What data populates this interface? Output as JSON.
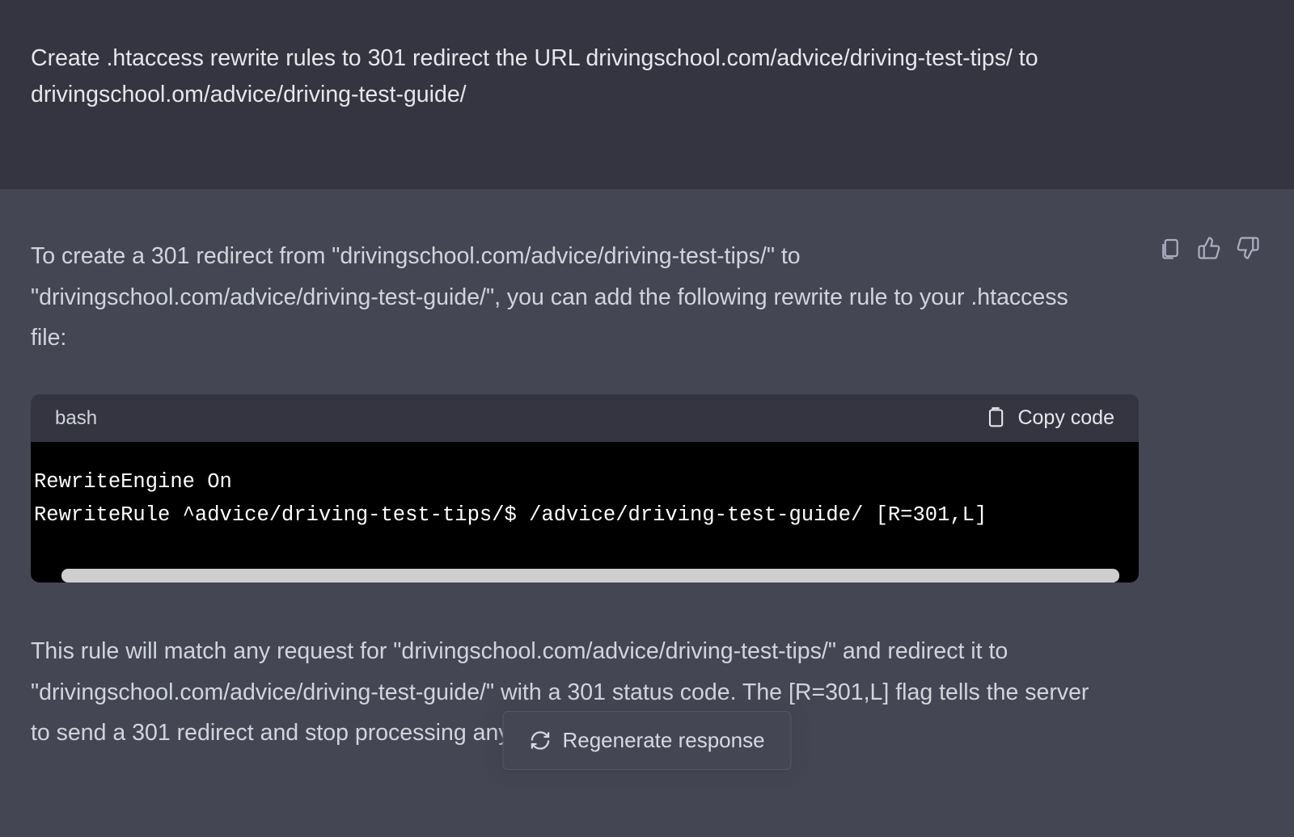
{
  "user": {
    "message": "Create .htaccess rewrite rules to 301 redirect the URL drivingschool.com/advice/driving-test-tips/ to drivingschool.om/advice/driving-test-guide/"
  },
  "assistant": {
    "intro": "To create a 301 redirect from \"drivingschool.com/advice/driving-test-tips/\" to \"drivingschool.com/advice/driving-test-guide/\", you can add the following rewrite rule to your .htaccess file:",
    "code": {
      "lang": "bash",
      "copy_label": "Copy code",
      "content": "RewriteEngine On\nRewriteRule ^advice/driving-test-tips/$ /advice/driving-test-guide/ [R=301,L]"
    },
    "outro": "This rule will match any request for \"drivingschool.com/advice/driving-test-tips/\" and redirect it to \"drivingschool.com/advice/driving-test-guide/\" with a 301 status code. The [R=301,L] flag tells the server to send a 301 redirect and stop processing any further rules."
  },
  "actions": {
    "regenerate": "Regenerate response"
  }
}
